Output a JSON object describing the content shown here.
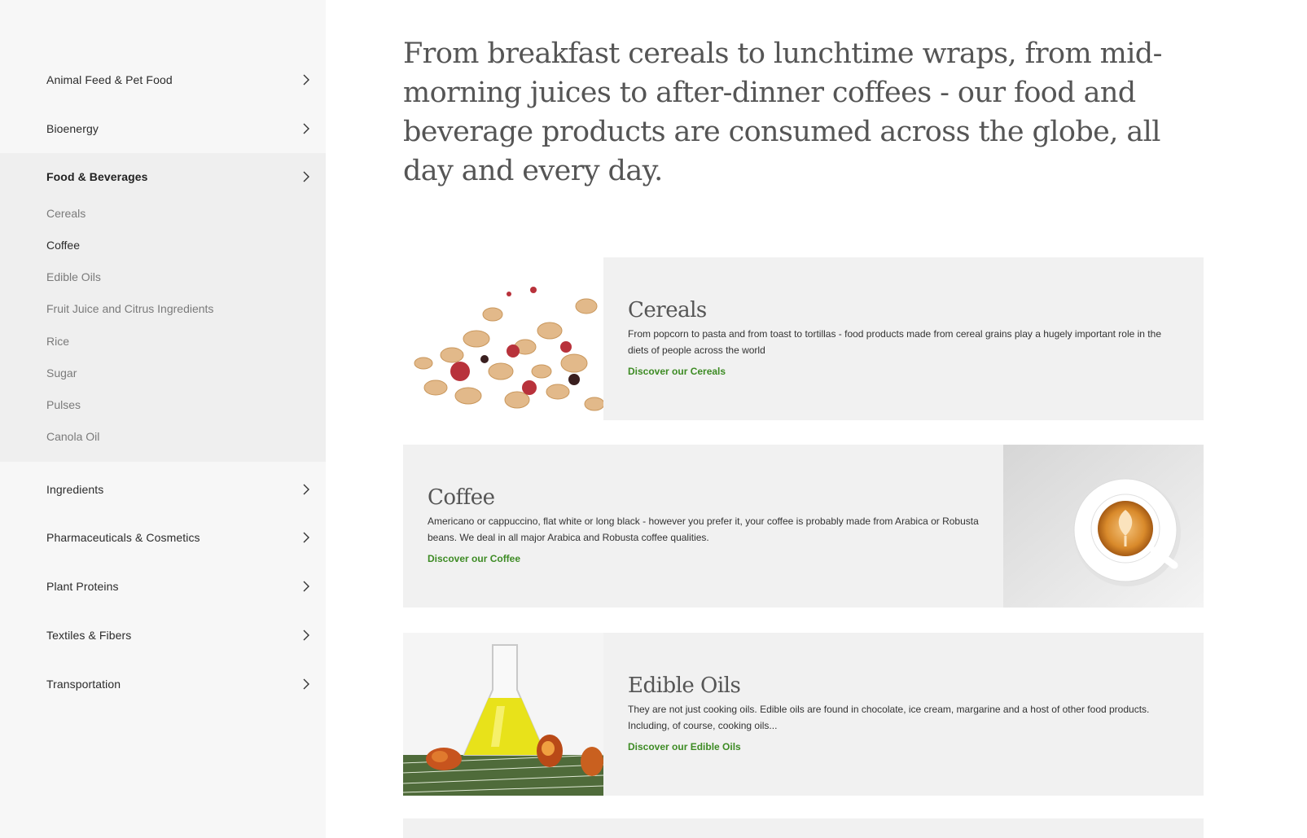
{
  "sidebar": {
    "items": [
      {
        "label": "Animal Feed & Pet Food"
      },
      {
        "label": "Bioenergy"
      },
      {
        "label": "Food & Beverages"
      },
      {
        "label": "Ingredients"
      },
      {
        "label": "Pharmaceuticals & Cosmetics"
      },
      {
        "label": "Plant Proteins"
      },
      {
        "label": "Textiles & Fibers"
      },
      {
        "label": "Transportation"
      }
    ],
    "active_item": "Food & Beverages",
    "sub_items": [
      {
        "label": "Cereals"
      },
      {
        "label": "Coffee"
      },
      {
        "label": "Edible Oils"
      },
      {
        "label": "Fruit Juice and Citrus Ingredients"
      },
      {
        "label": "Rice"
      },
      {
        "label": "Sugar"
      },
      {
        "label": "Pulses"
      },
      {
        "label": "Canola Oil"
      }
    ],
    "current_sub_item": "Coffee"
  },
  "main": {
    "intro": "From breakfast cereals to lunchtime wraps, from mid-morning juices to after-dinner coffees - our food and beverage products are consumed across the globe, all day and every day.",
    "cards": [
      {
        "title": "Cereals",
        "text": "From popcorn to pasta and from toast to tortillas - food products made from cereal grains play a hugely important role in the diets of people across the world",
        "link": "Discover our Cereals",
        "image": "granola-image"
      },
      {
        "title": "Coffee",
        "text": "Americano or cappuccino, flat white or long black - however you prefer it, your coffee is probably made from Arabica or Robusta beans. We deal in all major Arabica and Robusta coffee qualities.",
        "link": "Discover our Coffee",
        "image": "latte-cup-image"
      },
      {
        "title": "Edible Oils",
        "text": "They are not just cooking oils. Edible oils are found in chocolate, ice cream, margarine and a host of other food products. Including, of course, cooking oils...",
        "link": "Discover our Edible Oils",
        "image": "oil-flask-image"
      }
    ]
  },
  "colors": {
    "accent_link": "#3d8b24",
    "sidebar_bg": "#f7f7f7",
    "active_bg": "#efefef",
    "card_bg": "#f1f1f1"
  }
}
